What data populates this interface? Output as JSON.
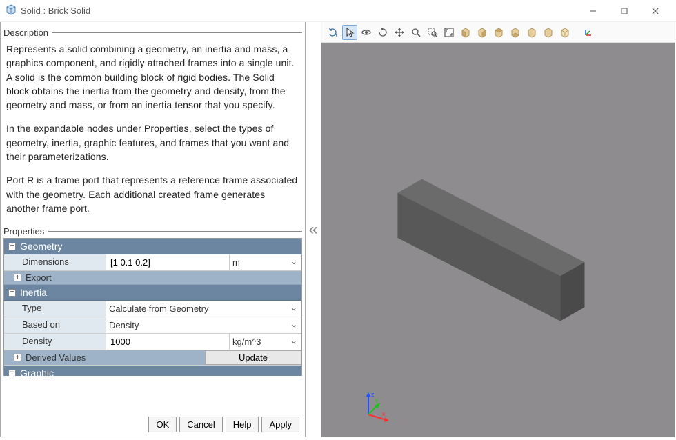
{
  "window": {
    "title": "Solid : Brick Solid"
  },
  "description": {
    "header": "Description",
    "p1": "Represents a solid combining a geometry, an inertia and mass, a graphics component, and rigidly attached frames into a single unit. A solid is the common building block of rigid bodies. The Solid block obtains the inertia from the geometry and density, from the geometry and mass, or from an inertia tensor that you specify.",
    "p2": "In the expandable nodes under Properties, select the types of geometry, inertia, graphic features, and frames that you want and their parameterizations.",
    "p3": "Port R is a frame port that represents a reference frame associated with the geometry. Each additional created frame generates another frame port."
  },
  "properties": {
    "header": "Properties",
    "geometry": {
      "label": "Geometry",
      "dimensions_label": "Dimensions",
      "dimensions_value": "[1 0.1 0.2]",
      "dimensions_unit": "m",
      "export_label": "Export"
    },
    "inertia": {
      "label": "Inertia",
      "type_label": "Type",
      "type_value": "Calculate from Geometry",
      "basedon_label": "Based on",
      "basedon_value": "Density",
      "density_label": "Density",
      "density_value": "1000",
      "density_unit": "kg/m^3",
      "derived_label": "Derived Values",
      "update_label": "Update"
    },
    "graphic": {
      "label": "Graphic"
    }
  },
  "buttons": {
    "ok": "OK",
    "cancel": "Cancel",
    "help": "Help",
    "apply": "Apply"
  },
  "toolbar": {
    "items": [
      "refresh-icon",
      "cursor-icon",
      "orbit-icon",
      "roll-icon",
      "pan-icon",
      "zoom-icon",
      "zoom-region-icon",
      "fit-icon",
      "view-front-icon",
      "view-back-icon",
      "view-top-icon",
      "view-bottom-icon",
      "view-left-icon",
      "view-right-icon",
      "view-iso-icon",
      "axes-icon"
    ],
    "selected": "cursor-icon"
  },
  "colors": {
    "group_bg": "#6c85a1",
    "subgroup_bg": "#9fb3c8",
    "viewport_bg": "#8e8c8f",
    "accent": "#7aa7d9"
  }
}
